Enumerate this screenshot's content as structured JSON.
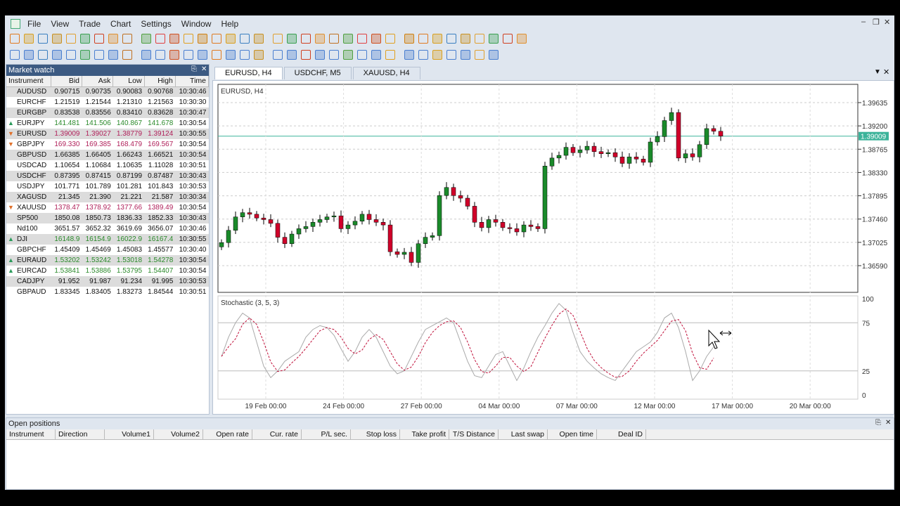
{
  "menu": [
    "File",
    "View",
    "Trade",
    "Chart",
    "Settings",
    "Window",
    "Help"
  ],
  "colors": {
    "bull": "#1a8a2a",
    "bear": "#d0002a",
    "panel_header": "#3c5a82",
    "price_tag": "#3cb39a"
  },
  "market_watch": {
    "title": "Market watch",
    "columns": [
      "Instrument",
      "Bid",
      "Ask",
      "Low",
      "High",
      "Time"
    ],
    "rows": [
      {
        "s": "AUDUSD",
        "b": "0.90715",
        "a": "0.90735",
        "l": "0.90083",
        "h": "0.90768",
        "t": "10:30:46",
        "d": ""
      },
      {
        "s": "EURCHF",
        "b": "1.21519",
        "a": "1.21544",
        "l": "1.21310",
        "h": "1.21563",
        "t": "10:30:30",
        "d": ""
      },
      {
        "s": "EURGBP",
        "b": "0.83538",
        "a": "0.83556",
        "l": "0.83410",
        "h": "0.83628",
        "t": "10:30:47",
        "d": ""
      },
      {
        "s": "EURJPY",
        "b": "141.481",
        "a": "141.506",
        "l": "140.867",
        "h": "141.678",
        "t": "10:30:54",
        "d": "up"
      },
      {
        "s": "EURUSD",
        "b": "1.39009",
        "a": "1.39027",
        "l": "1.38779",
        "h": "1.39124",
        "t": "10:30:55",
        "d": "dn"
      },
      {
        "s": "GBPJPY",
        "b": "169.330",
        "a": "169.385",
        "l": "168.479",
        "h": "169.567",
        "t": "10:30:54",
        "d": "dn"
      },
      {
        "s": "GBPUSD",
        "b": "1.66385",
        "a": "1.66405",
        "l": "1.66243",
        "h": "1.66521",
        "t": "10:30:54",
        "d": ""
      },
      {
        "s": "USDCAD",
        "b": "1.10654",
        "a": "1.10684",
        "l": "1.10635",
        "h": "1.11028",
        "t": "10:30:51",
        "d": ""
      },
      {
        "s": "USDCHF",
        "b": "0.87395",
        "a": "0.87415",
        "l": "0.87199",
        "h": "0.87487",
        "t": "10:30:43",
        "d": ""
      },
      {
        "s": "USDJPY",
        "b": "101.771",
        "a": "101.789",
        "l": "101.281",
        "h": "101.843",
        "t": "10:30:53",
        "d": ""
      },
      {
        "s": "XAGUSD",
        "b": "21.345",
        "a": "21.390",
        "l": "21.221",
        "h": "21.587",
        "t": "10:30:34",
        "d": ""
      },
      {
        "s": "XAUUSD",
        "b": "1378.47",
        "a": "1378.92",
        "l": "1377.66",
        "h": "1389.49",
        "t": "10:30:54",
        "d": "dn"
      },
      {
        "s": "SP500",
        "b": "1850.08",
        "a": "1850.73",
        "l": "1836.33",
        "h": "1852.33",
        "t": "10:30:43",
        "d": ""
      },
      {
        "s": "Nd100",
        "b": "3651.57",
        "a": "3652.32",
        "l": "3619.69",
        "h": "3656.07",
        "t": "10:30:46",
        "d": ""
      },
      {
        "s": "DJI",
        "b": "16148.9",
        "a": "16154.9",
        "l": "16022.9",
        "h": "16167.4",
        "t": "10:30:55",
        "d": "up"
      },
      {
        "s": "GBPCHF",
        "b": "1.45409",
        "a": "1.45469",
        "l": "1.45083",
        "h": "1.45577",
        "t": "10:30:40",
        "d": ""
      },
      {
        "s": "EURAUD",
        "b": "1.53202",
        "a": "1.53242",
        "l": "1.53018",
        "h": "1.54278",
        "t": "10:30:54",
        "d": "up"
      },
      {
        "s": "EURCAD",
        "b": "1.53841",
        "a": "1.53886",
        "l": "1.53795",
        "h": "1.54407",
        "t": "10:30:54",
        "d": "up"
      },
      {
        "s": "CADJPY",
        "b": "91.952",
        "a": "91.987",
        "l": "91.234",
        "h": "91.995",
        "t": "10:30:53",
        "d": ""
      },
      {
        "s": "GBPAUD",
        "b": "1.83345",
        "a": "1.83405",
        "l": "1.83273",
        "h": "1.84544",
        "t": "10:30:51",
        "d": ""
      }
    ]
  },
  "tabs": [
    "EURUSD, H4",
    "USDCHF, M5",
    "XAUUSD, H4"
  ],
  "chart_data": {
    "type": "candlestick",
    "title": "EURUSD, H4",
    "current_price": "1.39009",
    "price_ticks": [
      "1.39635",
      "1.39200",
      "1.38765",
      "1.38330",
      "1.37895",
      "1.37460",
      "1.37025",
      "1.36590"
    ],
    "ylim": [
      1.3659,
      1.39635
    ],
    "date_ticks": [
      "19 Feb 00:00",
      "24 Feb 00:00",
      "27 Feb 00:00",
      "04 Mar 00:00",
      "07 Mar 00:00",
      "12 Mar 00:00",
      "17 Mar 00:00",
      "20 Mar 00:00"
    ],
    "closes": [
      1.3702,
      1.3725,
      1.375,
      1.3758,
      1.3755,
      1.3748,
      1.3745,
      1.3738,
      1.3712,
      1.37,
      1.3718,
      1.3728,
      1.3732,
      1.374,
      1.3745,
      1.375,
      1.3752,
      1.3728,
      1.3735,
      1.3742,
      1.3755,
      1.3745,
      1.374,
      1.3735,
      1.3685,
      1.368,
      1.3684,
      1.3665,
      1.37,
      1.3712,
      1.3715,
      1.379,
      1.3805,
      1.379,
      1.3785,
      1.377,
      1.374,
      1.373,
      1.3745,
      1.374,
      1.373,
      1.3728,
      1.3722,
      1.3735,
      1.3732,
      1.3728,
      1.3845,
      1.386,
      1.3865,
      1.388,
      1.387,
      1.3875,
      1.3882,
      1.3872,
      1.3868,
      1.387,
      1.3862,
      1.385,
      1.3862,
      1.3858,
      1.3852,
      1.389,
      1.39,
      1.393,
      1.3945,
      1.386,
      1.3868,
      1.3862,
      1.3885,
      1.3915,
      1.391,
      1.3901
    ],
    "indicator": {
      "name": "Stochastic (3, 5, 3)",
      "ticks": [
        "100",
        "75",
        "25",
        "0"
      ],
      "k": [
        40,
        60,
        75,
        85,
        80,
        55,
        30,
        18,
        25,
        35,
        40,
        45,
        60,
        68,
        72,
        70,
        62,
        48,
        35,
        45,
        60,
        68,
        60,
        45,
        30,
        22,
        25,
        40,
        55,
        68,
        72,
        76,
        80,
        75,
        55,
        35,
        20,
        18,
        30,
        42,
        45,
        30,
        15,
        28,
        45,
        60,
        72,
        85,
        95,
        88,
        65,
        45,
        35,
        28,
        22,
        18,
        15,
        25,
        35,
        45,
        50,
        55,
        65,
        80,
        85,
        70,
        45,
        15,
        25,
        40,
        50
      ]
    }
  },
  "open_positions": {
    "title": "Open positions",
    "columns": [
      "Instrument",
      "Direction",
      "Volume1",
      "Volume2",
      "Open rate",
      "Cur. rate",
      "P/L sec.",
      "Stop loss",
      "Take profit",
      "T/S Distance",
      "Last swap",
      "Open time",
      "Deal ID"
    ]
  }
}
